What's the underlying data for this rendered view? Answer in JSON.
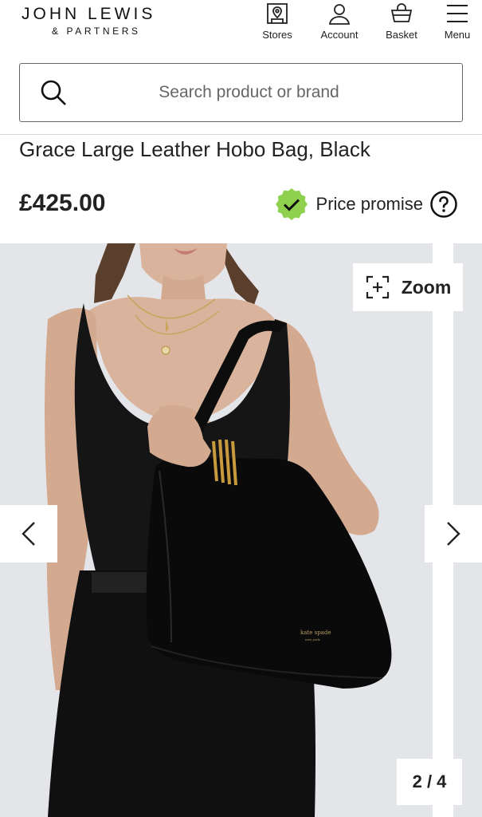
{
  "brand": {
    "line1": "JOHN LEWIS",
    "line2": "& PARTNERS"
  },
  "nav": [
    {
      "label": "Stores",
      "icon": "store-icon"
    },
    {
      "label": "Account",
      "icon": "account-icon"
    },
    {
      "label": "Basket",
      "icon": "basket-icon"
    },
    {
      "label": "Menu",
      "icon": "menu-icon"
    }
  ],
  "search": {
    "placeholder": "Search product or brand"
  },
  "product": {
    "title": "Grace Large Leather Hobo Bag, Black",
    "price": "£425.00",
    "price_promise_label": "Price promise"
  },
  "gallery": {
    "zoom_label": "Zoom",
    "counter": "2 / 4",
    "bag_logo_line1": "kate spade",
    "bag_logo_line2": "new york"
  },
  "colors": {
    "accent_green": "#8fd14f",
    "text": "#222222",
    "gallery_bg": "#e4e5e9"
  }
}
